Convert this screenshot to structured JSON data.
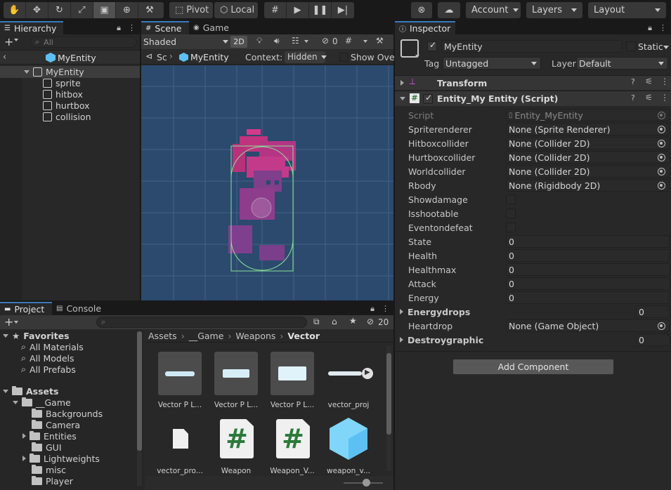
{
  "toolbar": {
    "pivot_label": "Pivot",
    "local_label": "Local",
    "account_label": "Account",
    "layers_label": "Layers",
    "layout_label": "Layout"
  },
  "hierarchy": {
    "tab_label": "Hierarchy",
    "search_placeholder": "All",
    "scene_title": "MyEntity",
    "root": "MyEntity",
    "children": [
      "sprite",
      "hitbox",
      "hurtbox",
      "collision"
    ]
  },
  "scene": {
    "tab_scene": "Scene",
    "tab_game": "Game",
    "shading_mode": "Shaded",
    "mode_2d": "2D",
    "hidden_count": "0",
    "breadcrumb_sc": "Sc",
    "breadcrumb_entity": "MyEntity",
    "context_label": "Context:",
    "context_value": "Hidden",
    "show_overrides": "Show Over"
  },
  "project": {
    "tab_project": "Project",
    "tab_console": "Console",
    "hidden_count": "20",
    "favorites_label": "Favorites",
    "favorites": [
      "All Materials",
      "All Models",
      "All Prefabs"
    ],
    "assets_label": "Assets",
    "game_folder": "__Game",
    "game_children": [
      "Backgrounds",
      "Camera",
      "Entities",
      "GUI",
      "Lightweights",
      "misc",
      "Player"
    ],
    "breadcrumb": [
      "Assets",
      "__Game",
      "Weapons",
      "Vector"
    ],
    "assets": [
      {
        "name": "Vector P L...",
        "kind": "sprite"
      },
      {
        "name": "Vector P L...",
        "kind": "sprite2"
      },
      {
        "name": "Vector P L...",
        "kind": "sprite3"
      },
      {
        "name": "vector_proj",
        "kind": "prefab-anim"
      },
      {
        "name": "vector_pro...",
        "kind": "file"
      },
      {
        "name": "Weapon",
        "kind": "script"
      },
      {
        "name": "Weapon_V...",
        "kind": "script"
      },
      {
        "name": "weapon_v...",
        "kind": "prefab"
      }
    ]
  },
  "inspector": {
    "tab_label": "Inspector",
    "object_name": "MyEntity",
    "static_label": "Static",
    "tag_label": "Tag",
    "tag_value": "Untagged",
    "layer_label": "Layer",
    "layer_value": "Default",
    "transform_label": "Transform",
    "script_component_label": "Entity_My Entity (Script)",
    "script_label": "Script",
    "script_value": "Entity_MyEntity",
    "fields": [
      {
        "label": "Spriterenderer",
        "value": "None (Sprite Renderer)"
      },
      {
        "label": "Hitboxcollider",
        "value": "None (Collider 2D)"
      },
      {
        "label": "Hurtboxcollider",
        "value": "None (Collider 2D)"
      },
      {
        "label": "Worldcollider",
        "value": "None (Collider 2D)"
      },
      {
        "label": "Rbody",
        "value": "None (Rigidbody 2D)"
      }
    ],
    "bools": [
      "Showdamage",
      "Isshootable",
      "Eventondefeat"
    ],
    "numbers": [
      {
        "label": "State",
        "value": "0"
      },
      {
        "label": "Health",
        "value": "0"
      },
      {
        "label": "Healthmax",
        "value": "0"
      },
      {
        "label": "Attack",
        "value": "0"
      },
      {
        "label": "Energy",
        "value": "0"
      }
    ],
    "energydrops_label": "Energydrops",
    "energydrops_value": "0",
    "heartdrop_label": "Heartdrop",
    "heartdrop_value": "None (Game Object)",
    "destroygraphic_label": "Destroygraphic",
    "destroygraphic_value": "0",
    "add_component": "Add Component"
  },
  "colors": {
    "scene_bg": "#2b4a6e",
    "accent": "#3a79bb",
    "collider": "#8de29a"
  }
}
